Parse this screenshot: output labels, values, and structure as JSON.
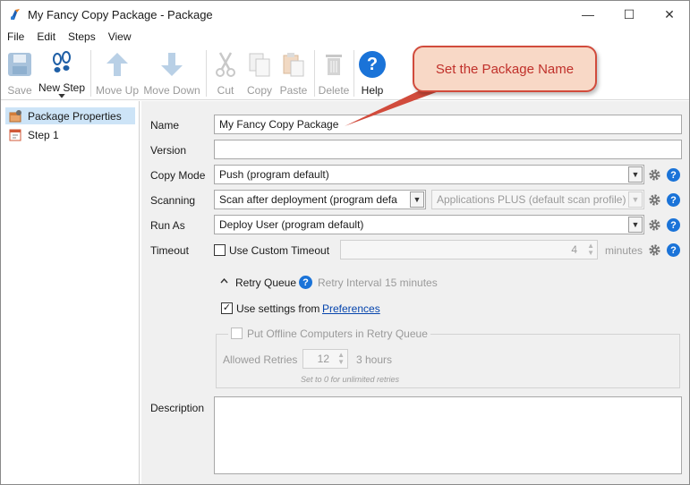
{
  "window": {
    "title": "My Fancy Copy Package - Package",
    "minimize_glyph": "—",
    "maximize_glyph": "☐",
    "close_glyph": "✕"
  },
  "menu": [
    "File",
    "Edit",
    "Steps",
    "View"
  ],
  "toolbar": {
    "save": "Save",
    "new_step": "New Step",
    "move_up": "Move Up",
    "move_down": "Move Down",
    "cut": "Cut",
    "copy": "Copy",
    "paste": "Paste",
    "delete": "Delete",
    "help": "Help",
    "help_glyph": "?"
  },
  "tree": {
    "items": [
      {
        "label": "Package Properties",
        "icon": "package-icon"
      },
      {
        "label": "Step 1",
        "icon": "step-icon"
      }
    ]
  },
  "form": {
    "name_label": "Name",
    "name_value": "My Fancy Copy Package",
    "version_label": "Version",
    "version_value": "",
    "copy_mode_label": "Copy Mode",
    "copy_mode_value": "Push (program default)",
    "scanning_label": "Scanning",
    "scanning_value": "Scan after deployment (program defa",
    "scan_profile_value": "Applications PLUS (default scan profile)",
    "run_as_label": "Run As",
    "run_as_value": "Deploy User (program default)",
    "timeout_label": "Timeout",
    "timeout_checkbox_label": "Use Custom Timeout",
    "timeout_value": "4",
    "timeout_unit": "minutes",
    "retry_queue_label": "Retry Queue",
    "retry_interval_label": "Retry Interval",
    "retry_interval_value": "15 minutes",
    "use_settings_label": "Use settings from",
    "preferences_link": "Preferences",
    "offline_label": "Put Offline Computers in Retry Queue",
    "allowed_retries_label": "Allowed Retries",
    "allowed_retries_value": "12",
    "retries_duration": "3 hours",
    "retries_hint": "Set to 0 for unlimited retries",
    "description_label": "Description",
    "description_value": ""
  },
  "callout": {
    "text": "Set the Package Name"
  },
  "colors": {
    "accent": "#1a73d8",
    "selection": "#cde4f7",
    "callout_fill": "#f8d8c6",
    "callout_border": "#d14b3c"
  }
}
